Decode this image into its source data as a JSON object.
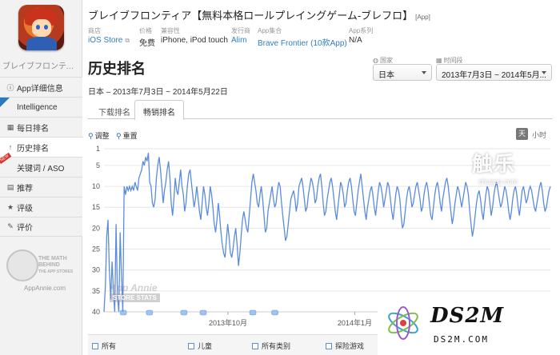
{
  "sidebar": {
    "app_name": "ブレイブフロンティア...",
    "items": [
      {
        "icon": "info-icon",
        "glyph": "i",
        "label": "App详细信息"
      },
      {
        "icon": "intelligence-icon",
        "glyph": "",
        "label": "Intelligence"
      },
      {
        "icon": "calendar-icon",
        "glyph": "▦",
        "label": "每日排名"
      },
      {
        "icon": "arrow-up-icon",
        "glyph": "↑",
        "label": "历史排名"
      },
      {
        "icon": "tag-icon",
        "glyph": "",
        "label": "关键词 / ASO"
      },
      {
        "icon": "recommend-icon",
        "glyph": "▤",
        "label": "推荐"
      },
      {
        "icon": "star-icon",
        "glyph": "★",
        "label": "评级"
      },
      {
        "icon": "comment-icon",
        "glyph": "✎",
        "label": "评价"
      }
    ],
    "new_badge": "NEW",
    "logo_text_1": "THE MATH",
    "logo_text_2": "BEHIND",
    "logo_text_3": "THE APP STORES",
    "logo_site": "AppAnnie.com"
  },
  "header": {
    "title": "ブレイブフロンティア【無料本格ロールプレイングゲーム-ブレフロ】",
    "title_tag": "[App]",
    "meta": [
      {
        "label": "商店",
        "value": "iOS Store"
      },
      {
        "label": "价格",
        "value": "免费"
      },
      {
        "label": "兼容性",
        "value": "iPhone, iPod touch"
      },
      {
        "label": "发行商",
        "value": "Alim"
      },
      {
        "label": "App集合",
        "value": "Brave Frontier (10款App)"
      },
      {
        "label": "App系列",
        "value": "N/A"
      }
    ]
  },
  "main": {
    "page_title": "历史排名",
    "date_range": "日本 – 2013年7月3日 ~ 2014年5月22日",
    "country_label": "国家",
    "country_value": "日本",
    "period_label": "时间段",
    "period_value": "2013年7月3日 ~ 2014年5月...",
    "tabs": [
      "下载排名",
      "畅销排名"
    ],
    "tools": {
      "adjust": "调整",
      "reset": "重置"
    },
    "toggle_day": "天",
    "toggle_hour": "小时",
    "footer_checks": [
      "所有",
      "儿童",
      "所有类别",
      "探险游戏"
    ]
  },
  "watermarks": {
    "chuapp_big": "触乐",
    "chuapp_small": "chuapp.com",
    "annie_1": "App Annie",
    "annie_2": "STORE STATS",
    "ds2m_big": "DS2M",
    "ds2m_small": "DS2M.COM"
  },
  "colors": {
    "line": "#5b8be0",
    "link": "#2f7fc1",
    "annotation": "#9fc3ee"
  },
  "chart_data": {
    "type": "line",
    "title": "",
    "xlabel": "",
    "ylabel": "",
    "y_reversed": true,
    "ylim": [
      1,
      40
    ],
    "yticks": [
      1,
      5,
      10,
      15,
      20,
      25,
      30,
      35,
      40
    ],
    "x_ticks": [
      {
        "label": "2013年10月",
        "index": 90
      },
      {
        "label": "2014年1月",
        "index": 182
      }
    ],
    "x_range_days": 324,
    "grid": "horizontal",
    "series": [
      {
        "values": [
          40,
          34,
          22,
          18,
          30,
          37,
          28,
          35,
          40,
          19,
          36,
          40,
          21,
          31,
          40,
          10,
          12,
          10,
          11,
          10,
          11,
          10,
          11,
          9,
          10,
          11,
          8,
          7,
          6,
          4,
          5,
          3,
          4,
          2,
          9,
          10,
          14,
          15,
          13,
          8,
          5,
          3,
          6,
          10,
          14,
          11,
          9,
          6,
          4,
          8,
          14,
          17,
          13,
          8,
          11,
          12,
          9,
          6,
          10,
          12,
          16,
          14,
          10,
          7,
          6,
          9,
          12,
          15,
          13,
          10,
          13,
          16,
          18,
          14,
          10,
          12,
          15,
          17,
          14,
          10,
          12,
          15,
          19,
          21,
          18,
          14,
          17,
          21,
          24,
          26,
          27,
          23,
          19,
          22,
          26,
          27,
          25,
          22,
          20,
          24,
          29,
          26,
          22,
          18,
          16,
          18,
          20,
          21,
          17,
          13,
          9,
          7,
          9,
          11,
          14,
          15,
          12,
          10,
          13,
          17,
          21,
          20,
          16,
          14,
          12,
          10,
          13,
          15,
          14,
          11,
          9,
          10,
          14,
          17,
          20,
          23,
          22,
          19,
          16,
          13,
          12,
          11,
          13,
          16,
          14,
          10,
          9,
          8,
          10,
          13,
          16,
          15,
          12,
          10,
          8,
          9,
          11,
          14,
          13,
          10,
          8,
          7,
          10,
          14,
          17,
          16,
          13,
          11,
          9,
          8,
          10,
          13,
          16,
          18,
          15,
          12,
          9,
          10,
          12,
          15,
          14,
          11,
          9,
          8,
          10,
          13,
          16,
          17,
          14,
          11,
          9,
          7,
          10,
          13,
          16,
          18,
          15,
          13,
          11,
          10,
          12,
          15,
          17,
          14,
          11,
          9,
          10,
          12,
          15,
          13,
          11,
          9,
          10,
          13,
          16,
          18,
          15,
          12,
          10,
          11,
          13,
          17,
          20,
          19,
          16,
          13,
          11,
          10,
          12,
          15,
          14,
          12,
          10,
          9,
          11,
          13,
          16,
          15,
          12,
          10,
          9,
          11,
          14,
          17,
          18,
          15,
          12,
          10,
          9,
          11,
          14,
          16,
          13,
          11,
          9,
          8,
          10,
          13,
          16,
          19,
          17,
          14,
          12,
          10,
          11,
          13,
          15,
          13,
          11,
          9,
          10,
          12,
          16,
          19,
          22,
          20,
          17,
          14,
          12,
          11,
          13,
          16,
          18,
          15,
          12,
          10,
          11,
          14,
          17,
          15,
          12,
          10,
          9,
          11,
          13,
          15,
          14,
          12,
          10,
          11,
          13,
          16,
          18,
          16,
          13,
          11,
          10,
          12,
          15,
          17,
          14,
          11,
          10,
          12,
          14,
          13,
          11,
          10,
          11,
          13,
          15,
          16,
          14,
          12,
          10,
          9,
          11,
          14,
          16,
          15,
          13,
          11,
          10
        ]
      }
    ]
  }
}
